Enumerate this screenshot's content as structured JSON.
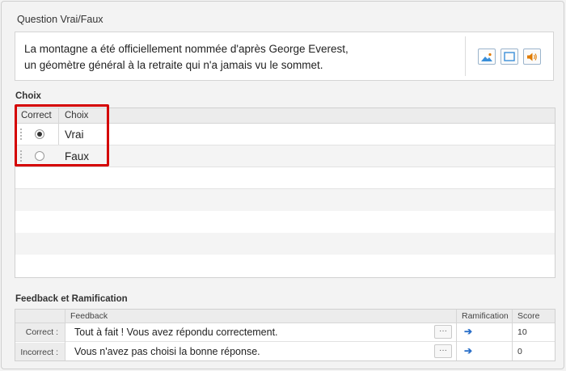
{
  "question": {
    "title": "Question Vrai/Faux",
    "line1": "La montagne a été officiellement nommée d'après George Everest,",
    "line2": "un géomètre général à la retraite qui n'a jamais vu le sommet.",
    "media_buttons": [
      {
        "icon": "image-icon",
        "color": "#3a8fd9"
      },
      {
        "icon": "video-icon",
        "color": "#3a8fd9"
      },
      {
        "icon": "audio-icon",
        "color": "#e07b00"
      }
    ]
  },
  "choices": {
    "section_label": "Choix",
    "columns": {
      "correct": "Correct",
      "choice": "Choix"
    },
    "rows": [
      {
        "text": "Vrai",
        "correct": true
      },
      {
        "text": "Faux",
        "correct": false
      }
    ]
  },
  "feedback": {
    "section_label": "Feedback et Ramification",
    "columns": {
      "feedback": "Feedback",
      "branching": "Ramification",
      "score": "Score"
    },
    "rows": [
      {
        "label": "Correct :",
        "text": "Tout à fait ! Vous avez répondu correctement.",
        "more": "···",
        "score": "10"
      },
      {
        "label": "Incorrect :",
        "text": "Vous n'avez pas choisi la bonne réponse.",
        "more": "···",
        "score": "0"
      }
    ]
  },
  "colors": {
    "highlight": "#d40000",
    "link_arrow": "#2a6fc9"
  }
}
